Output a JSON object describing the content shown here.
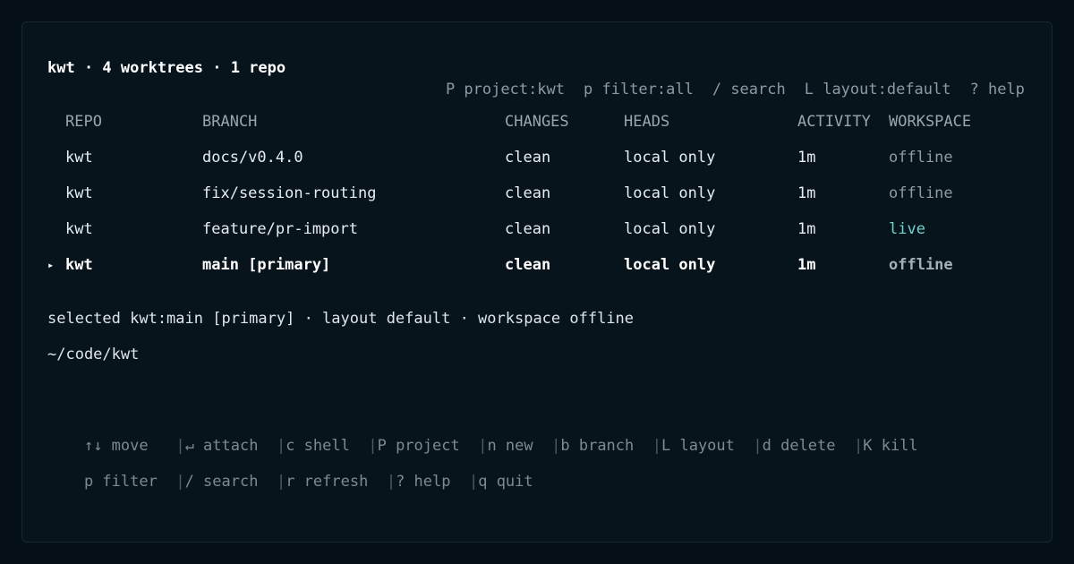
{
  "header": {
    "title": "kwt · 4 worktrees · 1 repo",
    "hints": [
      "P project:kwt",
      "p filter:all",
      "/ search",
      "L layout:default",
      "? help"
    ]
  },
  "table": {
    "columns": [
      "REPO",
      "BRANCH",
      "CHANGES",
      "HEADS",
      "ACTIVITY",
      "WORKSPACE"
    ],
    "selected_marker": "▸",
    "rows": [
      {
        "repo": "kwt",
        "branch": "docs/v0.4.0",
        "changes": "clean",
        "heads": "local only",
        "activity": "1m",
        "workspace": "offline",
        "selected": false
      },
      {
        "repo": "kwt",
        "branch": "fix/session-routing",
        "changes": "clean",
        "heads": "local only",
        "activity": "1m",
        "workspace": "offline",
        "selected": false
      },
      {
        "repo": "kwt",
        "branch": "feature/pr-import",
        "changes": "clean",
        "heads": "local only",
        "activity": "1m",
        "workspace": "live",
        "selected": false
      },
      {
        "repo": "kwt",
        "branch": "main [primary]",
        "changes": "clean",
        "heads": "local only",
        "activity": "1m",
        "workspace": "offline",
        "selected": true
      }
    ]
  },
  "status": {
    "selected_line": "selected kwt:main [primary] · layout default · workspace offline",
    "path": "~/code/kwt"
  },
  "keybindings": {
    "separator": "|",
    "line1": [
      "↑↓ move",
      "↵ attach",
      "c shell",
      "P project",
      "n new",
      "b branch",
      "L layout",
      "d delete",
      "K kill"
    ],
    "line2": [
      "p filter",
      "/ search",
      "r refresh",
      "? help",
      "q quit"
    ]
  },
  "colors": {
    "background": "#07141c",
    "live": "#6fd3cf",
    "offline": "#8f9aa2"
  }
}
